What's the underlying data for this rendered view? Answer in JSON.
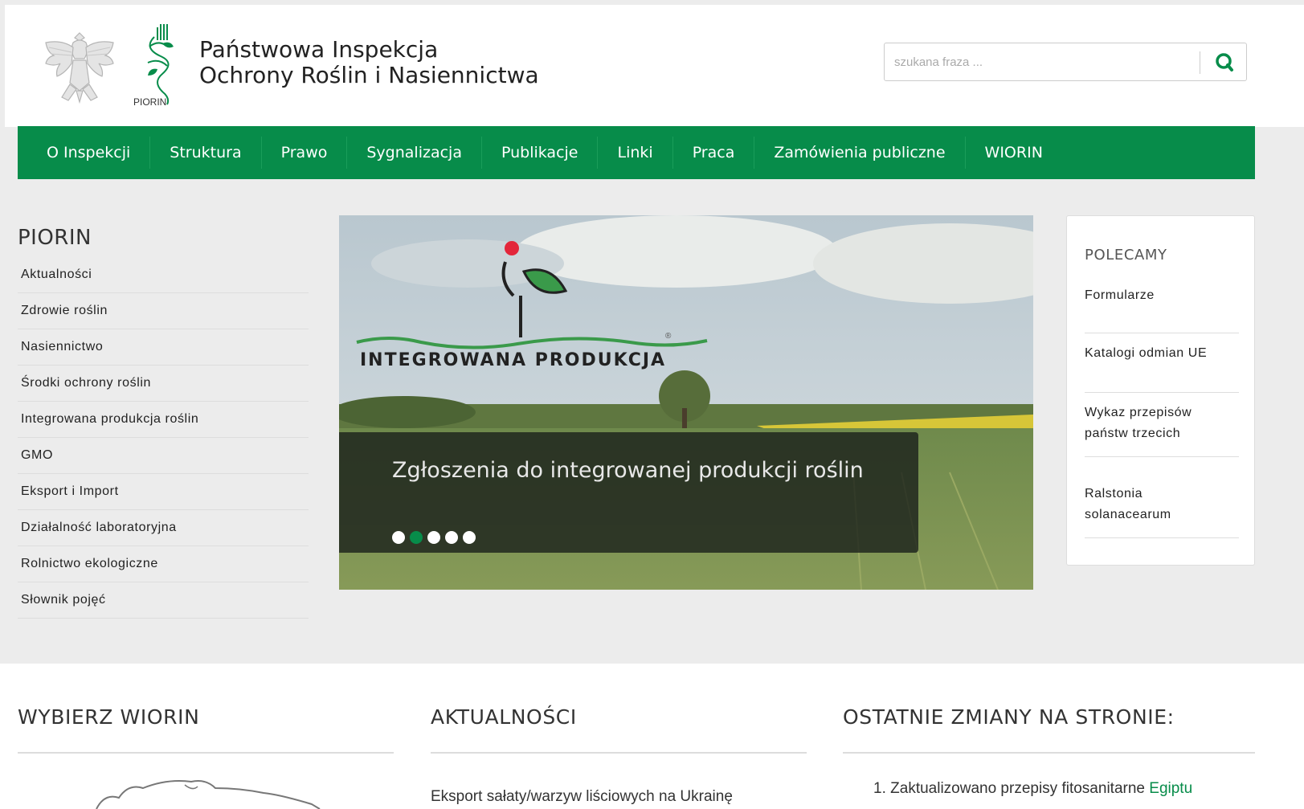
{
  "header": {
    "title_line1": "Państwowa Inspekcja",
    "title_line2": "Ochrony Roślin i Nasiennictwa",
    "logo_text": "PIORIN",
    "search": {
      "placeholder": "szukana fraza ..."
    }
  },
  "nav": {
    "items": [
      "O Inspekcji",
      "Struktura",
      "Prawo",
      "Sygnalizacja",
      "Publikacje",
      "Linki",
      "Praca",
      "Zamówienia publiczne",
      "WIORIN"
    ]
  },
  "sidebar": {
    "title": "PIORIN",
    "items": [
      "Aktualności",
      "Zdrowie roślin",
      "Nasiennictwo",
      "Środki ochrony roślin",
      "Integrowana produkcja roślin",
      "GMO",
      "Eksport i Import",
      "Działalność laboratoryjna",
      "Rolnictwo ekologiczne",
      "Słownik pojęć"
    ]
  },
  "slider": {
    "logo_text": "INTEGROWANA PRODUKCJA",
    "caption": "Zgłoszenia do integrowanej produkcji roślin",
    "slide_count": 5,
    "active_slide": 2
  },
  "recommend": {
    "title": "POLECAMY",
    "items": [
      {
        "line1": "Formularze",
        "line2": ""
      },
      {
        "line1": "Katalogi odmian UE",
        "line2": ""
      },
      {
        "line1": "Wykaz przepisów",
        "line2": "państw trzecich"
      },
      {
        "line1": "Ralstonia",
        "line2": "solanacearum"
      }
    ]
  },
  "bottom": {
    "col1_title": "WYBIERZ WIORIN",
    "col2_title": "AKTUALNOŚCI",
    "col3_title": "OSTATNIE ZMIANY NA STRONIE:",
    "news_item": "Eksport sałaty/warzyw liściowych na Ukrainę",
    "change_number": "1.",
    "change_text": "Zaktualizowano przepisy fitosanitarne",
    "change_link": "Egiptu"
  },
  "colors": {
    "brand_green": "#078c4a",
    "accent_red": "#e3263a"
  }
}
